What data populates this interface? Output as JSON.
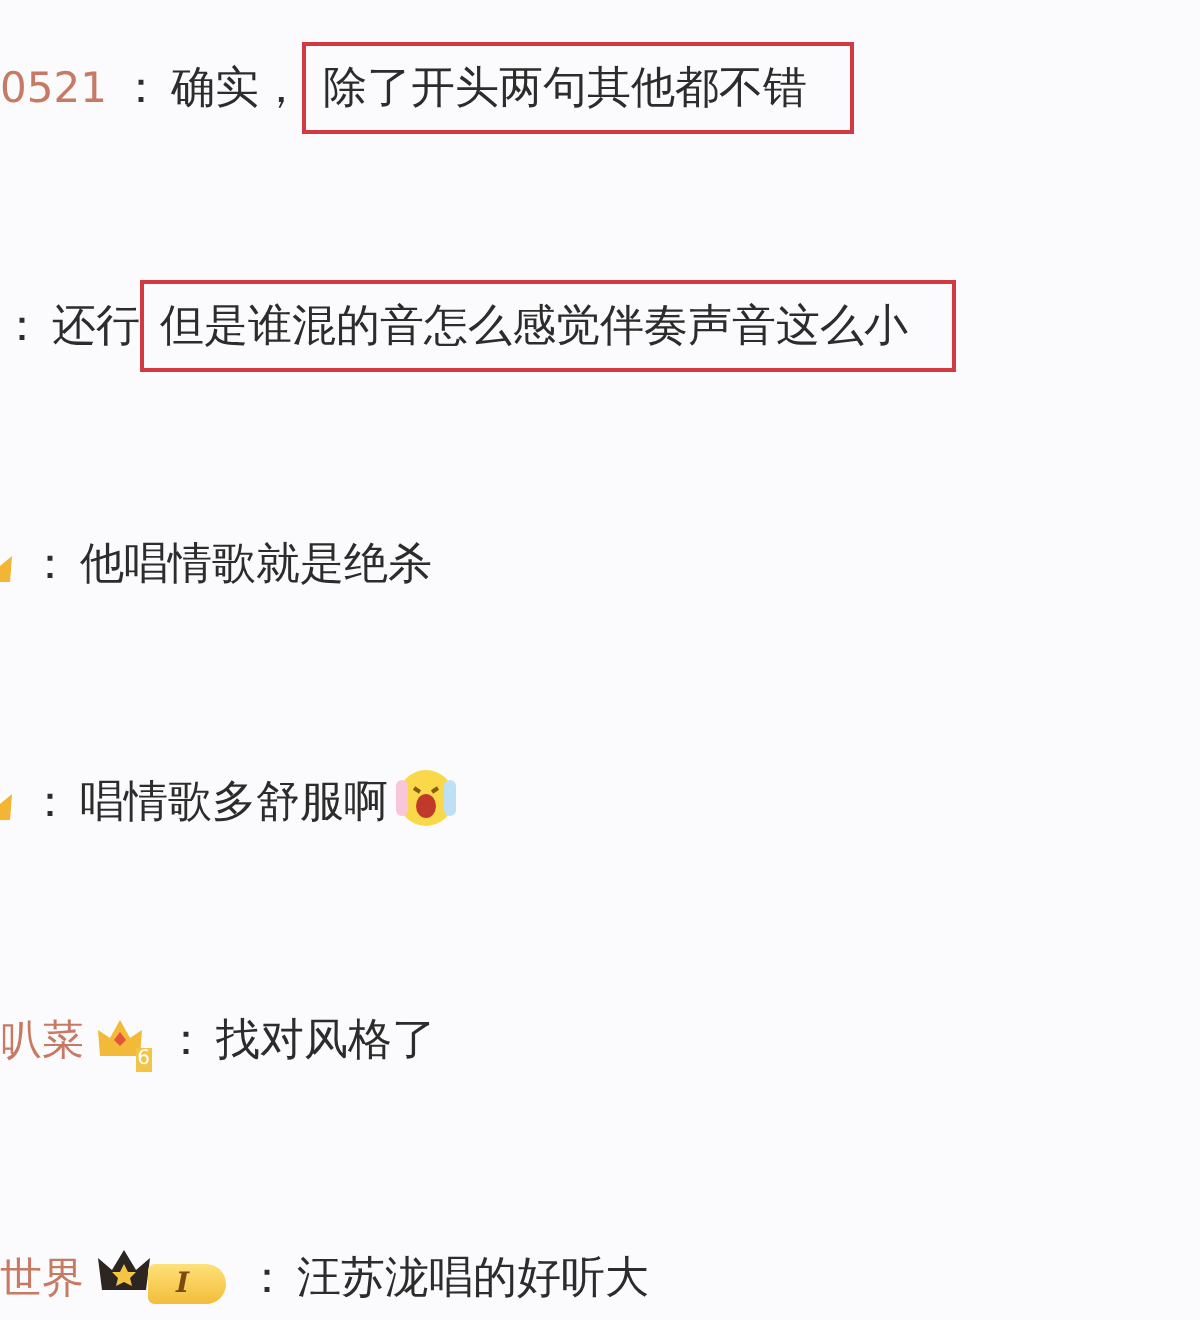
{
  "comments": [
    {
      "user": "0521",
      "separator": "：",
      "segments": [
        {
          "text": "确实，",
          "highlighted": false
        },
        {
          "text": "除了开头两句其他都不错",
          "highlighted": true
        }
      ]
    },
    {
      "separator": "：",
      "segments": [
        {
          "text": "还行",
          "highlighted": false
        },
        {
          "text": "但是谁混的音怎么感觉伴奏声音这么小",
          "highlighted": true
        }
      ]
    },
    {
      "badges": [
        {
          "kind": "crown-cut"
        }
      ],
      "separator": "：",
      "segments": [
        {
          "text": "他唱情歌就是绝杀",
          "highlighted": false
        }
      ]
    },
    {
      "badges": [
        {
          "kind": "crown-cut"
        }
      ],
      "separator": "：",
      "segments": [
        {
          "text": "唱情歌多舒服啊",
          "highlighted": false
        }
      ],
      "emoji": true
    },
    {
      "user": "叭菜",
      "badges": [
        {
          "kind": "crown",
          "label": "6"
        }
      ],
      "separator": "：",
      "segments": [
        {
          "text": "找对风格了",
          "highlighted": false
        }
      ]
    },
    {
      "user": "世界",
      "badges": [
        {
          "kind": "black-crown"
        },
        {
          "kind": "pill",
          "label": "I"
        }
      ],
      "separator": "：",
      "segments": [
        {
          "text": "汪苏泷唱的好听大",
          "highlighted": false
        }
      ]
    }
  ]
}
